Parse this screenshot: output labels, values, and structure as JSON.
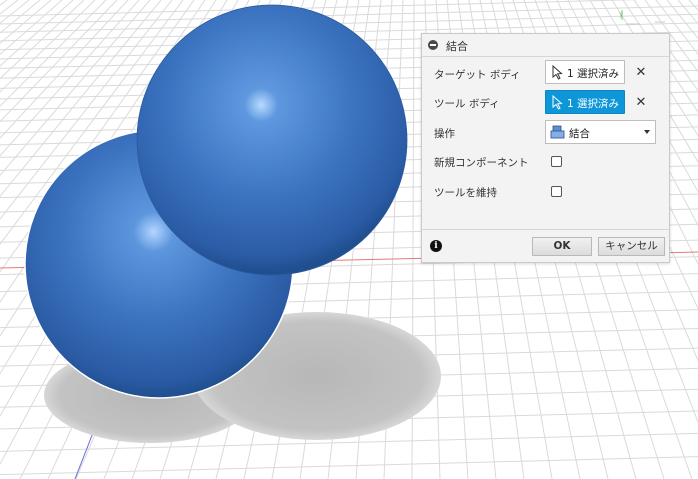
{
  "dialog": {
    "title": "結合",
    "target_body": {
      "label": "ターゲット ボディ",
      "value": "1 選択済み"
    },
    "tool_body": {
      "label": "ツール ボディ",
      "value": "1 選択済み"
    },
    "operation": {
      "label": "操作",
      "value": "結合"
    },
    "new_component": {
      "label": "新規コンポーネント",
      "checked": false
    },
    "keep_tools": {
      "label": "ツールを維持",
      "checked": false
    },
    "ok_label": "OK",
    "cancel_label": "キャンセル"
  },
  "viewport": {
    "sphere_color": "#3a72bf",
    "active_color": "#0d96d8"
  }
}
